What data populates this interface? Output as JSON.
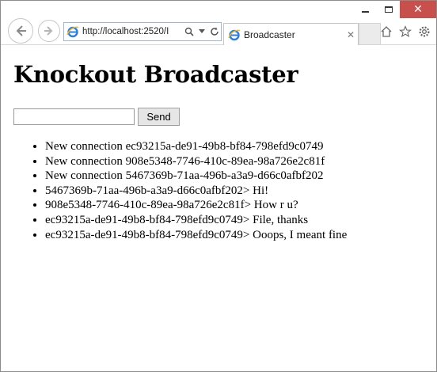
{
  "browser": {
    "address": "http://localhost:2520/I",
    "tab_title": "Broadcaster",
    "icons": [
      "back-icon",
      "forward-icon",
      "ie-icon",
      "search-icon",
      "dropdown-icon",
      "refresh-icon",
      "close-icon",
      "home-icon",
      "favorites-icon",
      "settings-icon"
    ],
    "close_glyph": "✕",
    "tab_close_glyph": "✕"
  },
  "page": {
    "title": "Knockout Broadcaster",
    "input_value": "",
    "send_label": "Send",
    "messages": [
      "New connection ec93215a-de91-49b8-bf84-798efd9c0749",
      "New connection 908e5348-7746-410c-89ea-98a726e2c81f",
      "New connection 5467369b-71aa-496b-a3a9-d66c0afbf202",
      "5467369b-71aa-496b-a3a9-d66c0afbf202> Hi!",
      "908e5348-7746-410c-89ea-98a726e2c81f> How r u?",
      "ec93215a-de91-49b8-bf84-798efd9c0749> File, thanks",
      "ec93215a-de91-49b8-bf84-798efd9c0749> Ooops, I meant fine"
    ]
  }
}
